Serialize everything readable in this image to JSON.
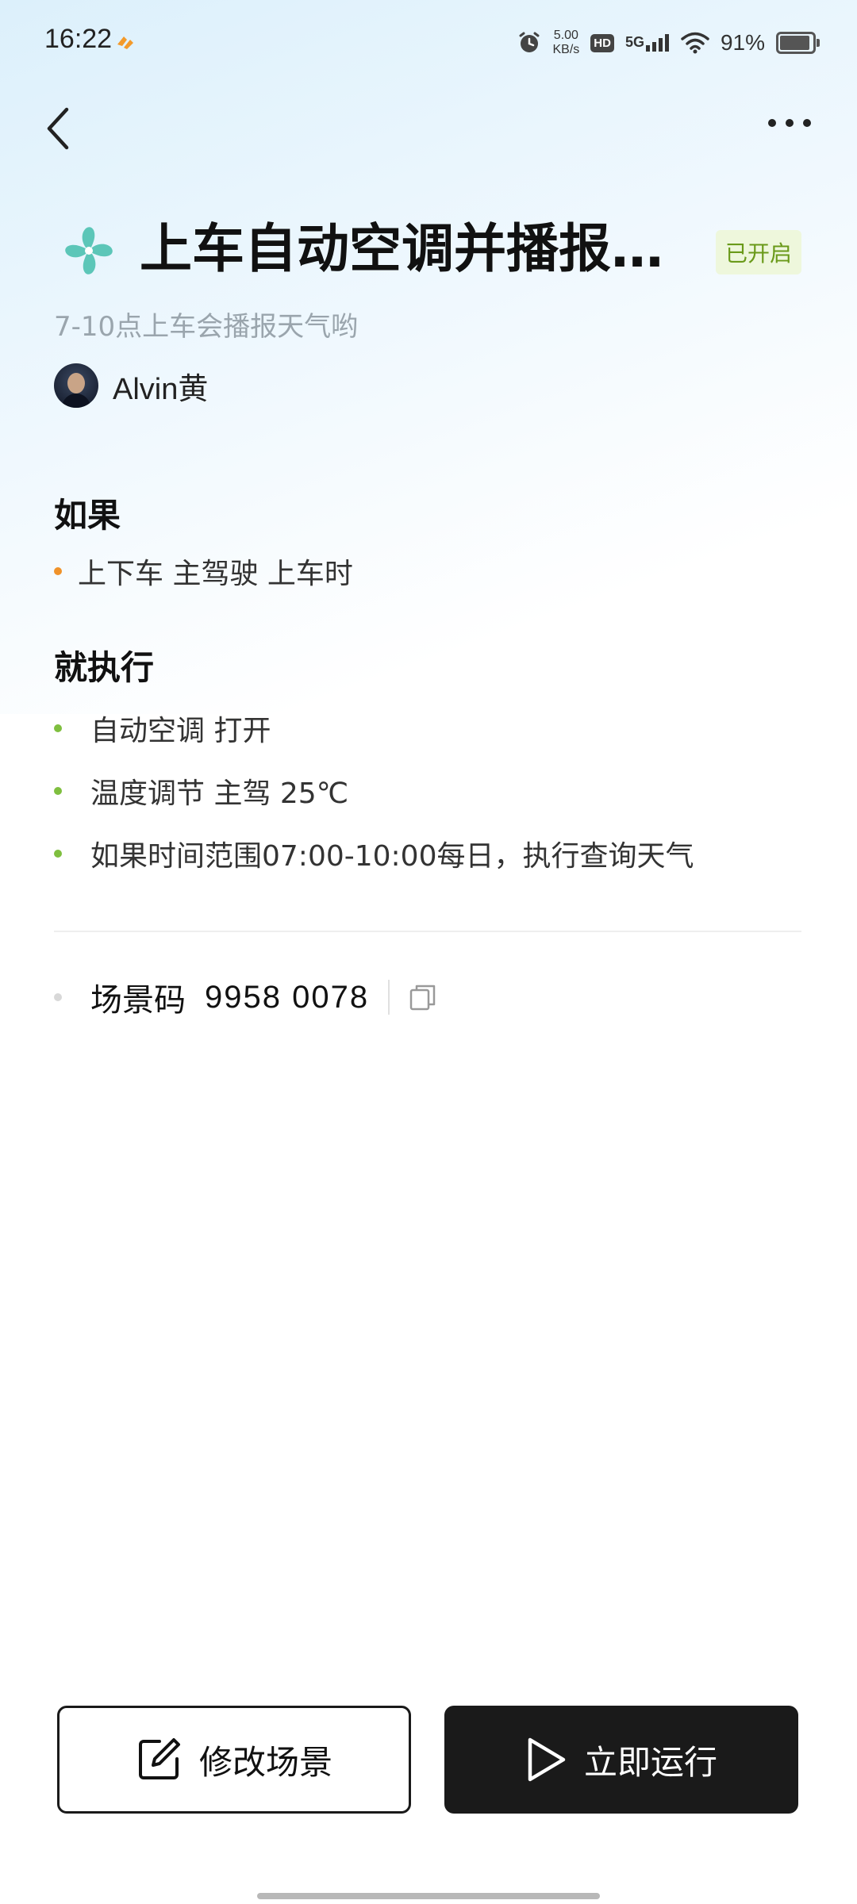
{
  "status_bar": {
    "time": "16:22",
    "speed_value": "5.00",
    "speed_unit": "KB/s",
    "hd": "HD",
    "network": "5G",
    "battery": "91%",
    "icons": [
      "orange-app-icon",
      "alarm-icon",
      "signal-icon",
      "wifi-icon",
      "battery-icon"
    ]
  },
  "header": {
    "back_icon": "chevron-left-icon",
    "more_icon": "more-dots-icon"
  },
  "scene": {
    "icon": "fan-icon",
    "icon_color": "#5cc6b8",
    "title": "上车自动空调并播报天气",
    "status": "已开启",
    "subtitle": "7-10点上车会播报天气哟",
    "author": "Alvin黄"
  },
  "condition": {
    "title": "如果",
    "items": [
      "上下车 主驾驶 上车时"
    ]
  },
  "actions": {
    "title": "就执行",
    "items": [
      "自动空调 打开",
      "温度调节 主驾 25℃",
      "如果时间范围07:00-10:00每日，执行查询天气"
    ]
  },
  "scene_code": {
    "label": "场景码",
    "value": "9958 0078",
    "copy_icon": "copy-icon"
  },
  "buttons": {
    "edit": "修改场景",
    "run": "立即运行"
  },
  "colors": {
    "accent_green": "#6a9a1a",
    "condition_dot": "#f0922a",
    "action_dot": "#7fbf3f",
    "dark_button": "#1a1a1a"
  }
}
